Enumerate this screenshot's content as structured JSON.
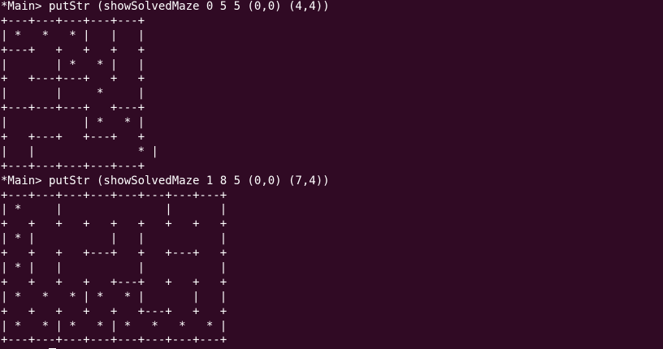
{
  "terminal": {
    "colors": {
      "background": "#300a24",
      "foreground": "#ffffff",
      "cursor": "#ffffff"
    },
    "lines": [
      "*Main> putStr (showSolvedMaze 0 5 5 (0,0) (4,4))",
      "+---+---+---+---+---+",
      "| *   *   * |   |   |",
      "+---+   +   +   +   +",
      "|       | *   * |   |",
      "+   +---+---+   +   +",
      "|       |     *     |",
      "+---+---+---+   +---+",
      "|           | *   * |",
      "+   +---+   +---+   +",
      "|   |               * |",
      "+---+---+---+---+---+",
      "*Main> putStr (showSolvedMaze 1 8 5 (0,0) (7,4))",
      "+---+---+---+---+---+---+---+---+",
      "| *     |               |       |",
      "+   +   +   +   +   +   +   +   +",
      "| * |           |   |           |",
      "+   +   +   +---+   +   +---+   +",
      "| * |   |           |           |",
      "+   +   +   +   +---+   +   +   +",
      "| *   *   * | *   * |       |   |",
      "+   +   +   +   +   +---+   +   +",
      "| *   * | *   * | *   *   *   * |",
      "+---+---+---+---+---+---+---+---+"
    ],
    "prompt": "*Main> ",
    "input": ""
  }
}
